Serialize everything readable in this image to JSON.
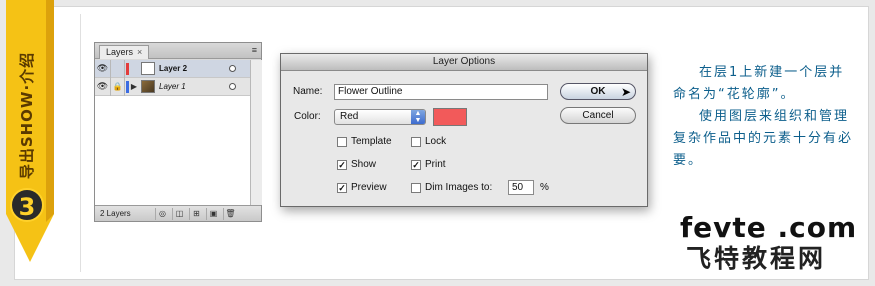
{
  "side_ribbon": {
    "text": "导出SHOW·介绍",
    "step_number": "3",
    "color": "#f5c215"
  },
  "layers_panel": {
    "tab_label": "Layers",
    "close_glyph": "×",
    "menu_glyph": "≡",
    "rows": [
      {
        "name": "Layer 2",
        "selected": true,
        "color": "#e23c3c",
        "thumbnail": "blank",
        "visible_glyph": "👁",
        "lock_glyph": ""
      },
      {
        "name": "Layer 1",
        "selected": false,
        "color": "#3c6ce2",
        "thumbnail": "image",
        "visible_glyph": "👁",
        "lock_glyph": "🔒"
      }
    ],
    "footer": {
      "count_label": "2 Layers"
    }
  },
  "dialog": {
    "title": "Layer Options",
    "name_label": "Name:",
    "name_value": "Flower Outline",
    "color_label": "Color:",
    "color_value": "Red",
    "swatch_color": "#f25a5a",
    "checkboxes": {
      "template": {
        "label": "Template",
        "checked": false
      },
      "lock": {
        "label": "Lock",
        "checked": false
      },
      "show": {
        "label": "Show",
        "checked": true
      },
      "print": {
        "label": "Print",
        "checked": true
      },
      "preview": {
        "label": "Preview",
        "checked": true
      },
      "dim": {
        "label": "Dim Images to:",
        "checked": false
      }
    },
    "dim_value": "50",
    "dim_unit": "%",
    "ok_label": "OK",
    "cancel_label": "Cancel"
  },
  "description": {
    "para1": "在层1上新建一个层并命名为“花轮廓”。",
    "para2": "使用图层来组织和管理复杂作品中的元素十分有必要。"
  },
  "brand": {
    "latin": "fevte .com",
    "chinese": "飞特教程网"
  }
}
